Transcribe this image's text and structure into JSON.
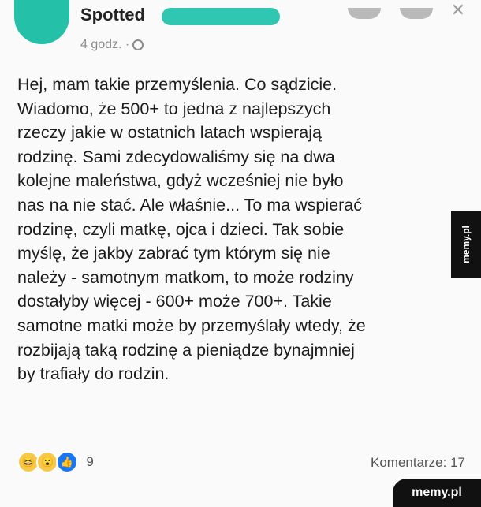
{
  "post": {
    "author": "Spotted",
    "time": "4 godz. ·",
    "text_lines": [
      "Hej, mam takie przemyślenia. Co sądzicie.",
      "Wiadomo, że 500+ to jedna z najlepszych",
      "rzeczy jakie w ostatnich latach wspierają",
      "rodzinę. Sami zdecydowaliśmy się na dwa",
      "kolejne maleństwa, gdyż wcześniej nie było",
      "nas na nie stać. Ale właśnie... To ma wspierać",
      "rodzinę, czyli matkę, ojca i dzieci. Tak sobie",
      "myślę, że jakby zabrać tym którym się nie",
      "należy - samotnym matkom, to może rodziny",
      "dostałyby więcej - 600+ może 700+. Takie",
      "samotne matki może by przemyślały wtedy, że",
      "rozbijają taką rodzinę a pieniądze bynajmniej",
      "by trafiały do rodzin."
    ],
    "reactions": {
      "icons": [
        "haha",
        "wow",
        "like"
      ],
      "count": "9"
    },
    "comments_label": "Komentarze: 17"
  },
  "watermarks": {
    "side": "memy.pl",
    "corner": "memy.pl"
  },
  "colors": {
    "avatar": "#25c0a8",
    "like": "#1877f2",
    "emoji": "#f7c84a"
  }
}
